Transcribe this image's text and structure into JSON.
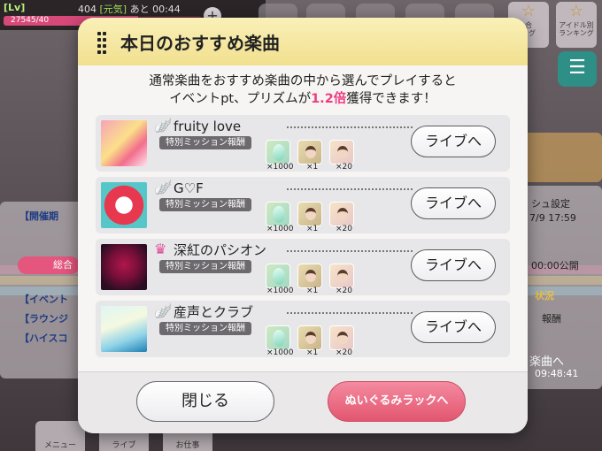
{
  "hud": {
    "level_label": "[Lv]",
    "level": "404",
    "stamina_label": "[元気]",
    "remaining_label": "あと 00:44",
    "exp_text": "27545/40",
    "plus": "+"
  },
  "top_right": {
    "ranking1_label": "合\nング",
    "ranking2_label": "アイドル別\nランキング"
  },
  "background_text": {
    "event_status": "【開催期",
    "overall": "総合",
    "list_line1": "【イベント",
    "list_line2": "【ラウンジ",
    "list_line3": "【ハイスコ",
    "refresh": "シュ設定",
    "refresh_date": "7/9 17:59",
    "release_time": "00:00公開",
    "situation": "状況",
    "reward": "報酬",
    "songs_label": "楽曲へ",
    "countdown": "09:48:41",
    "tab_menu": "メニュー",
    "tab_live": "ライブ",
    "tab_shop": "お仕事"
  },
  "modal": {
    "title": "本日のおすすめ楽曲",
    "intro_line1": "通常楽曲をおすすめ楽曲の中から選んでプレイすると",
    "intro_line2_pre": "イベントpt、プリズムが",
    "intro_multiplier": "1.2倍",
    "intro_line2_post": "獲得できます！",
    "close_label": "閉じる",
    "rack_label": "ぬいぐるみラックへ"
  },
  "songs": [
    {
      "name": "fruity love",
      "mission": "特別ミッション報酬",
      "qty1": "×1000",
      "qty2": "×1",
      "qty3": "×20",
      "button": "ライブへ",
      "attr_color": "#f2b233"
    },
    {
      "name": "G♡F",
      "mission": "特別ミッション報酬",
      "qty1": "×1000",
      "qty2": "×1",
      "qty3": "×20",
      "button": "ライブへ",
      "attr_color": "#f2b233"
    },
    {
      "name": "深紅のパシオン",
      "mission": "特別ミッション報酬",
      "qty1": "×1000",
      "qty2": "×1",
      "qty3": "×20",
      "button": "ライブへ",
      "attr_color": "#e04b97"
    },
    {
      "name": "産声とクラブ",
      "mission": "特別ミッション報酬",
      "qty1": "×1000",
      "qty2": "×1",
      "qty3": "×20",
      "button": "ライブへ",
      "attr_color": "#f2b233"
    }
  ],
  "colors": {
    "accent_pink": "#ee3d82",
    "header_yellow": "#f1e08f",
    "rack_button": "#e2566f"
  }
}
